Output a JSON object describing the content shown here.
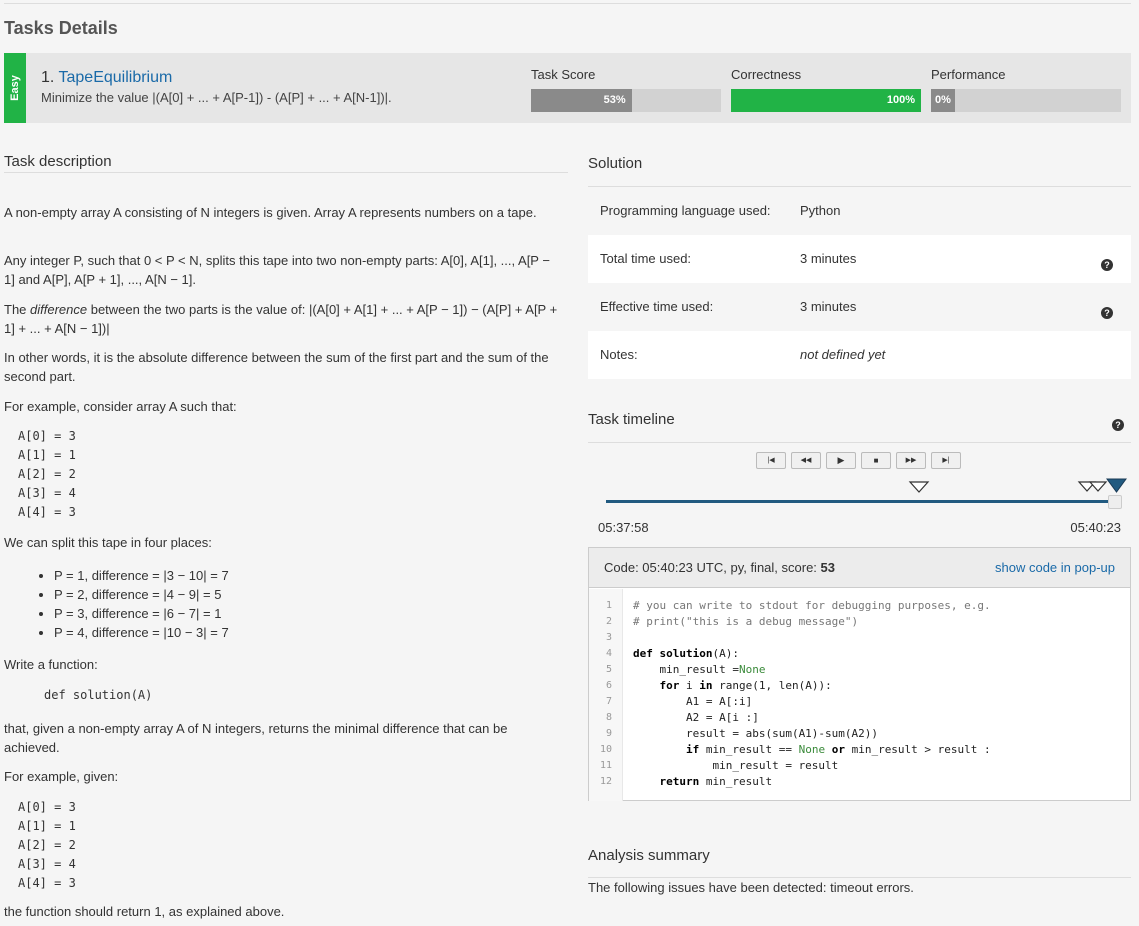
{
  "page_title": "Tasks Details",
  "task": {
    "difficulty": "Easy",
    "number": "1.",
    "name": "TapeEquilibrium",
    "summary": "Minimize the value |(A[0] + ... + A[P-1]) - (A[P] + ... + A[N-1])|."
  },
  "metrics": [
    {
      "label": "Task Score",
      "value": "53%",
      "fraction": 0.53,
      "color": "#8a8a8a"
    },
    {
      "label": "Correctness",
      "value": "100%",
      "fraction": 1.0,
      "color": "#21b346"
    },
    {
      "label": "Performance",
      "value": "0%",
      "fraction": 0.0,
      "color": "#8a8a8a"
    }
  ],
  "description": {
    "title": "Task description",
    "p1": "A non-empty array A consisting of N integers is given. Array A represents numbers on a tape.",
    "p2": "Any integer P, such that 0 < P < N, splits this tape into two non-empty parts: A[0], A[1], ..., A[P − 1] and A[P], A[P + 1], ..., A[N − 1].",
    "p3_pre": "The ",
    "p3_em": "difference",
    "p3_post": " between the two parts is the value of: |(A[0] + A[1] + ... + A[P − 1]) − (A[P] + A[P + 1] + ... + A[N − 1])|",
    "p4": "In other words, it is the absolute difference between the sum of the first part and the sum of the second part.",
    "p5": "For example, consider array A such that:",
    "array1": [
      "A[0] = 3",
      "A[1] = 1",
      "A[2] = 2",
      "A[3] = 4",
      "A[4] = 3"
    ],
    "p6": "We can split this tape in four places:",
    "splits": [
      "P = 1, difference = |3 − 10| = 7",
      "P = 2, difference = |4 − 9| = 5",
      "P = 3, difference = |6 − 7| = 1",
      "P = 4, difference = |10 − 3| = 7"
    ],
    "p7": "Write a function:",
    "signature": "def solution(A)",
    "p8": "that, given a non-empty array A of N integers, returns the minimal difference that can be achieved.",
    "p9": "For example, given:",
    "array2": [
      "A[0] = 3",
      "A[1] = 1",
      "A[2] = 2",
      "A[3] = 4",
      "A[4] = 3"
    ],
    "p10": "the function should return 1, as explained above."
  },
  "solution": {
    "title": "Solution",
    "rows": [
      {
        "key": "Programming language used:",
        "value": "Python"
      },
      {
        "key": "Total time used:",
        "value": "3 minutes"
      },
      {
        "key": "Effective time used:",
        "value": "3 minutes"
      },
      {
        "key": "Notes:",
        "value": "not defined yet"
      }
    ],
    "help_icon": "question-circle-icon"
  },
  "timeline": {
    "title": "Task timeline",
    "controls": [
      "first-icon",
      "rewind-icon",
      "play-icon",
      "stop-icon",
      "fast-forward-icon",
      "last-icon"
    ],
    "start_time": "05:37:58",
    "end_time": "05:40:23"
  },
  "code": {
    "header": "Code: 05:40:23 UTC, py, final, score:",
    "score": "53",
    "popup_link": "show code in pop-up",
    "lines": [
      {
        "n": "1",
        "segs": [
          {
            "t": "# you can write to stdout for debugging purposes, e.g.",
            "c": "cm"
          }
        ]
      },
      {
        "n": "2",
        "segs": [
          {
            "t": "# print(\"this is a debug message\")",
            "c": "cm"
          }
        ]
      },
      {
        "n": "3",
        "segs": []
      },
      {
        "n": "4",
        "segs": [
          {
            "t": "def",
            "c": "kw"
          },
          {
            "t": " ",
            "c": ""
          },
          {
            "t": "solution",
            "c": "kw"
          },
          {
            "t": "(A):",
            "c": ""
          }
        ]
      },
      {
        "n": "5",
        "segs": [
          {
            "t": "    min_result =",
            "c": ""
          },
          {
            "t": "None",
            "c": "nn"
          }
        ]
      },
      {
        "n": "6",
        "segs": [
          {
            "t": "    ",
            "c": ""
          },
          {
            "t": "for",
            "c": "kw"
          },
          {
            "t": " i ",
            "c": ""
          },
          {
            "t": "in",
            "c": "kw"
          },
          {
            "t": " range(1, len(A)):",
            "c": ""
          }
        ]
      },
      {
        "n": "7",
        "segs": [
          {
            "t": "        A1 = A[:i]",
            "c": ""
          }
        ]
      },
      {
        "n": "8",
        "segs": [
          {
            "t": "        A2 = A[i :]",
            "c": ""
          }
        ]
      },
      {
        "n": "9",
        "segs": [
          {
            "t": "        result = abs(sum(A1)-sum(A2))",
            "c": ""
          }
        ]
      },
      {
        "n": "10",
        "segs": [
          {
            "t": "        ",
            "c": ""
          },
          {
            "t": "if",
            "c": "kw"
          },
          {
            "t": " min_result == ",
            "c": ""
          },
          {
            "t": "None",
            "c": "nn"
          },
          {
            "t": " ",
            "c": ""
          },
          {
            "t": "or",
            "c": "kw"
          },
          {
            "t": " min_result > result :",
            "c": ""
          }
        ]
      },
      {
        "n": "11",
        "segs": [
          {
            "t": "            min_result = result",
            "c": ""
          }
        ]
      },
      {
        "n": "12",
        "segs": [
          {
            "t": "    ",
            "c": ""
          },
          {
            "t": "return",
            "c": "kw"
          },
          {
            "t": " min_result",
            "c": ""
          }
        ]
      }
    ]
  },
  "analysis": {
    "title": "Analysis summary",
    "text": "The following issues have been detected: timeout errors."
  }
}
